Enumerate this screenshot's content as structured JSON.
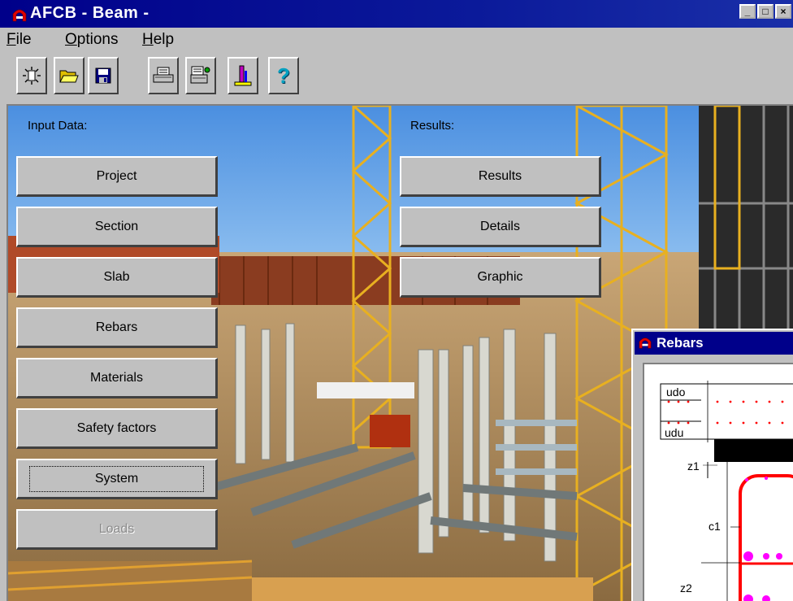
{
  "window": {
    "title": "AFCB - Beam  -",
    "controls": [
      "_",
      "□",
      "×"
    ]
  },
  "menu": [
    {
      "accel": "F",
      "rest": "ile"
    },
    {
      "accel": "O",
      "rest": "ptions"
    },
    {
      "accel": "H",
      "rest": "elp"
    }
  ],
  "toolbar": {
    "icons": [
      "new-icon",
      "open-folder-icon",
      "save-icon",
      "print-icon",
      "print-setup-icon",
      "report-icon",
      "help-icon"
    ],
    "help_glyph": "?"
  },
  "input_section": {
    "label": "Input Data:",
    "buttons": [
      "Project",
      "Section",
      "Slab",
      "Rebars",
      "Materials",
      "Safety factors",
      "System",
      "Loads"
    ]
  },
  "results_section": {
    "label": "Results:",
    "buttons": [
      "Results",
      "Details",
      "Graphic"
    ]
  },
  "rebars_window": {
    "title": "Rebars",
    "labels": {
      "udo": "udo",
      "udu": "udu",
      "z1": "z1",
      "c1": "c1",
      "z2": "z2"
    }
  },
  "colors": {
    "title_bar": "#00008a",
    "face": "#c0c0c0",
    "rebar_outline": "#ff0000",
    "rebar_points": "#ff00ff"
  }
}
